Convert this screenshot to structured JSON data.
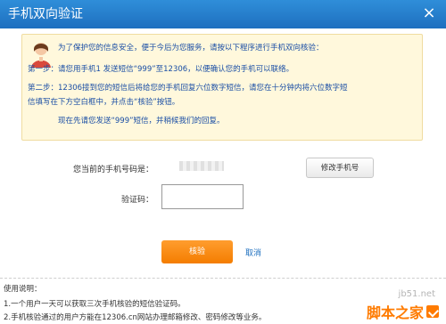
{
  "window": {
    "title": "手机双向验证",
    "close_icon": "close-icon"
  },
  "notice": {
    "avatar_icon": "customer-service-avatar-icon",
    "intro": "为了保护您的信息安全，便于今后为您服务，请按以下程序进行手机双向核验：",
    "step1": "第一步：请您用手机1            发送短信“999”至12306，以便确认您的手机可以联络。",
    "step2": "第二步：12306接到您的短信后将给您的手机回复六位数字短信，请您在十分钟内将六位数字短",
    "step2_cont": "信填写在下方空白框中，并点击“核验”按钮。",
    "closing": "现在先请您发送“999”短信，并稍候我们的回复。"
  },
  "form": {
    "phone_label": "您当前的手机号码是：",
    "modify_button": "修改手机号",
    "code_label": "验证码：",
    "code_value": "",
    "code_placeholder": ""
  },
  "actions": {
    "verify": "核验",
    "cancel": "取消"
  },
  "usage": {
    "title": "使用说明：",
    "item1": "1.一个用户一天可以获取三次手机核验的短信验证码。",
    "item2": "2.手机核验通过的用户方能在12306.cn网站办理邮箱修改、密码修改等业务。"
  },
  "watermark": {
    "site": "jb51.net",
    "logo_text": "脚本之家"
  },
  "colors": {
    "title_bar": "#1e6fbf",
    "notice_bg": "#fff8dc",
    "notice_text": "#1a4ea5",
    "verify_button": "#f47d00",
    "cancel_link": "#1e6fbf"
  }
}
